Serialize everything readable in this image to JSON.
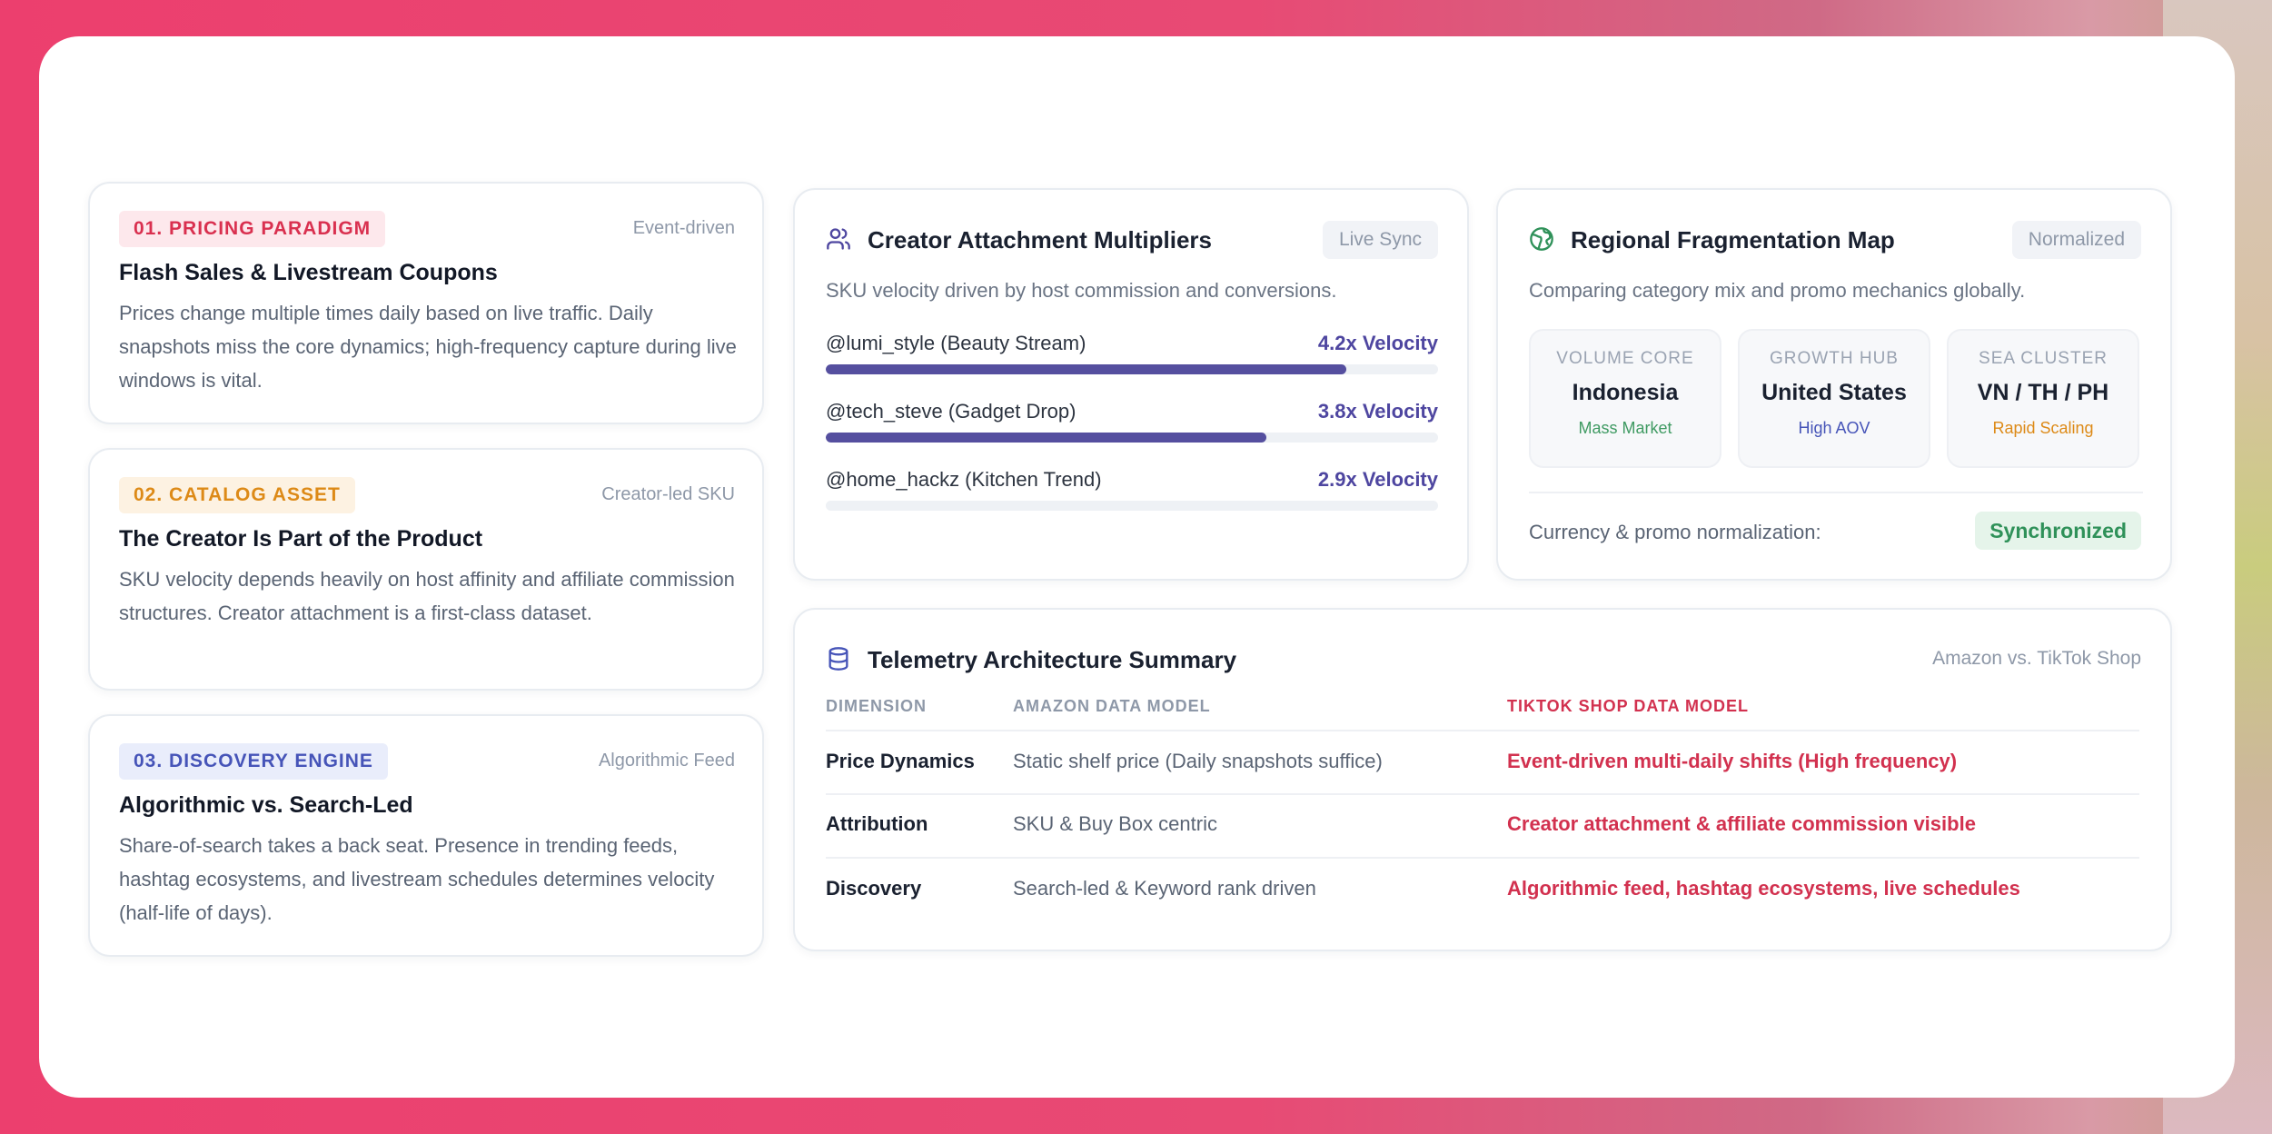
{
  "cards": [
    {
      "badge": "01. PRICING PARADIGM",
      "tag": "Event-driven",
      "title": "Flash Sales & Livestream Coupons",
      "desc": "Prices change multiple times daily based on live traffic. Daily snapshots miss the core dynamics; high-frequency capture during live windows is vital."
    },
    {
      "badge": "02. CATALOG ASSET",
      "tag": "Creator-led SKU",
      "title": "The Creator Is Part of the Product",
      "desc": "SKU velocity depends heavily on host affinity and affiliate commission structures. Creator attachment is a first-class dataset."
    },
    {
      "badge": "03. DISCOVERY ENGINE",
      "tag": "Algorithmic Feed",
      "title": "Algorithmic vs. Search-Led",
      "desc": "Share-of-search takes a back seat. Presence in trending feeds, hashtag ecosystems, and livestream schedules determines velocity (half-life of days)."
    }
  ],
  "creator": {
    "title": "Creator Attachment Multipliers",
    "chip": "Live Sync",
    "subtitle": "SKU velocity driven by host commission and conversions.",
    "rows": [
      {
        "name": "@lumi_style (Beauty Stream)",
        "value": "4.2x Velocity",
        "level": 0.85
      },
      {
        "name": "@tech_steve (Gadget Drop)",
        "value": "3.8x Velocity",
        "level": 0.72
      },
      {
        "name": "@home_hackz (Kitchen Trend)",
        "value": "2.9x Velocity",
        "level": 0.0
      }
    ]
  },
  "regional": {
    "title": "Regional Fragmentation Map",
    "chip": "Normalized",
    "subtitle": "Comparing category mix and promo mechanics globally.",
    "regions": [
      {
        "label": "VOLUME CORE",
        "name": "Indonesia",
        "sub": "Mass Market",
        "color": "#3f9a62"
      },
      {
        "label": "GROWTH HUB",
        "name": "United States",
        "sub": "High AOV",
        "color": "#4654b8"
      },
      {
        "label": "SEA CLUSTER",
        "name": "VN / TH / PH",
        "sub": "Rapid Scaling",
        "color": "#dd8a17"
      }
    ],
    "currency_label": "Currency & promo normalization:",
    "status": "Synchronized"
  },
  "telemetry": {
    "title": "Telemetry Architecture Summary",
    "right": "Amazon vs. TikTok Shop",
    "headers": [
      "DIMENSION",
      "AMAZON DATA MODEL",
      "TIKTOK SHOP DATA MODEL"
    ],
    "rows": [
      {
        "dimension": "Price Dynamics",
        "amazon": "Static shelf price (Daily snapshots suffice)",
        "tiktok": "Event-driven multi-daily shifts (High frequency)"
      },
      {
        "dimension": "Attribution",
        "amazon": "SKU & Buy Box centric",
        "tiktok": "Creator attachment & affiliate commission visible"
      },
      {
        "dimension": "Discovery",
        "amazon": "Search-led & Keyword rank driven",
        "tiktok": "Algorithmic feed, hashtag ecosystems, live schedules"
      }
    ]
  },
  "colors": {
    "accent_red": "#d2314f",
    "accent_purple": "#554f9f",
    "background_pink": "#ec3f6e"
  }
}
